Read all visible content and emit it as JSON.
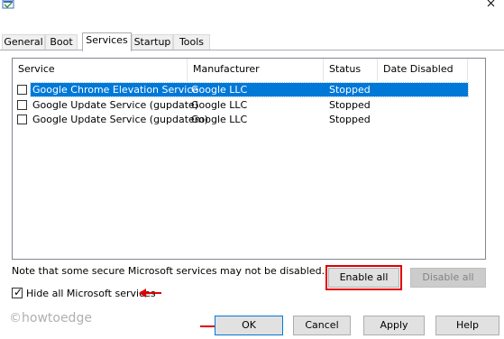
{
  "tabs": [
    {
      "label": "General",
      "active": false
    },
    {
      "label": "Boot",
      "active": false
    },
    {
      "label": "Services",
      "active": true
    },
    {
      "label": "Startup",
      "active": false
    },
    {
      "label": "Tools",
      "active": false
    }
  ],
  "services_table": {
    "columns": [
      "Service",
      "Manufacturer",
      "Status",
      "Date Disabled"
    ],
    "rows": [
      {
        "checked": false,
        "selected": true,
        "service": "Google Chrome Elevation Service",
        "manufacturer": "Google LLC",
        "status": "Stopped",
        "date_disabled": ""
      },
      {
        "checked": false,
        "selected": false,
        "service": "Google Update Service (gupdate)",
        "manufacturer": "Google LLC",
        "status": "Stopped",
        "date_disabled": ""
      },
      {
        "checked": false,
        "selected": false,
        "service": "Google Update Service (gupdatem)",
        "manufacturer": "Google LLC",
        "status": "Stopped",
        "date_disabled": ""
      }
    ]
  },
  "note": "Note that some secure Microsoft services may not be disabled.",
  "buttons": {
    "enable_all": "Enable all",
    "disable_all": "Disable all",
    "ok": "OK",
    "cancel": "Cancel",
    "apply": "Apply",
    "help": "Help"
  },
  "hide_ms": {
    "label": "Hide all Microsoft services",
    "checked": true
  },
  "watermark": "©howtoedge",
  "colors": {
    "selection": "#0078d7",
    "annotation_red": "#e00000",
    "button_face": "#e1e1e1"
  },
  "icons": [
    "app-icon",
    "close-icon",
    "check-icon",
    "arrow-left-icon",
    "arrow-right-icon"
  ]
}
